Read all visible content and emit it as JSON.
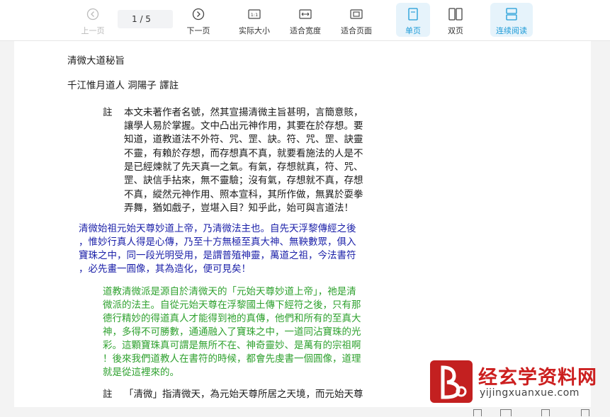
{
  "toolbar": {
    "prev_page": "上一页",
    "page_indicator": "1 / 5",
    "next_page": "下一页",
    "actual_size": "实际大小",
    "fit_width": "适合宽度",
    "fit_page": "适合页面",
    "single_page": "单页",
    "double_page": "双页",
    "continuous_reading": "连续阅读",
    "active_color": "#1d9bd7"
  },
  "document": {
    "title": "清微大道秘旨",
    "author": "千江惟月道人 洞陽子 譯註",
    "note_mark": "註",
    "note1_lines": [
      "本文未著作者名號，然其宣揚清微主旨甚明，言簡意賅，",
      "讓學人易於掌握。文中凸出元神作用，其要在於存想。要",
      "知道，道教道法不外符、咒、罡、訣。符、咒、罡、訣靈",
      "不靈，有賴於存想，而存想真不真，就要看施法的人是不",
      "是已經煉就了先天真一之氣。有氣，存想就真，符、咒、",
      "罡、訣信手拈來，無不靈驗；沒有氣，存想就不真，存想",
      "不真，縱然元神作用、照本宣科，其所作做，無異於耍拳",
      "弄舞，猶如戲子，豈堪入目？知乎此，始可與言道法！"
    ],
    "text_blue_lines": [
      "清微始祖元始天尊妙道上帝，乃清微法主也。自先天浮黎傳經之後",
      "，惟妙行真人得是心傳，乃至十方無極至真大神、無鞅數眾，俱入",
      "寶珠之中，同一段光明受用，是謂普殖神靈，萬道之祖，今法書符",
      "，必先畫一圓像，其為造化，便可見矣！"
    ],
    "text_green_lines": [
      "道教清微派是源自於清微天的「元始天尊妙道上帝」，祂是清",
      "微派的法主。自從元始天尊在浮黎國土傳下經符之後，只有那",
      "德行精妙的得道真人才能得到祂的真傳，他們和所有的至真大",
      "神，多得不可勝數，通通融入了寶珠之中，一道同沾寶珠的光",
      "彩。這顆寶珠真可謂是無所不在、神奇靈妙、是萬有的宗祖啊",
      "！後來我們道教人在書符的時候，都會先虔書一個圓像，道理",
      "就是從這裡來的。"
    ],
    "note2_line": "「清微」指清微天，為元始天尊所居之天境，而元始天尊"
  },
  "watermark": {
    "title": "经玄学资料网",
    "url": "yijingxuanxue.com"
  }
}
